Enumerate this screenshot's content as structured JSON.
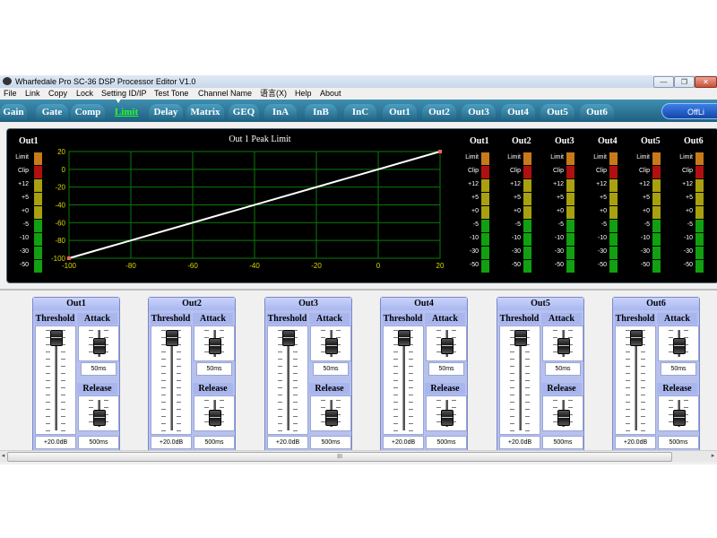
{
  "window": {
    "title": "Wharfedale Pro SC-36 DSP Processor Editor V1.0",
    "minimize_glyph": "—",
    "restore_glyph": "❐",
    "close_glyph": "✕"
  },
  "menu": [
    "File",
    "Link",
    "Copy",
    "Lock",
    "Setting ID/IP",
    "Test Tone",
    "Channel Name",
    "语言(X)",
    "Help",
    "About"
  ],
  "tabs": [
    {
      "label": "Gain",
      "active": false
    },
    {
      "label": "Gate",
      "active": false
    },
    {
      "label": "Comp",
      "active": false
    },
    {
      "label": "Limit",
      "active": true
    },
    {
      "label": "Delay",
      "active": false
    },
    {
      "label": "Matrix",
      "active": false
    },
    {
      "label": "GEQ",
      "active": false
    },
    {
      "label": "InA",
      "active": false
    },
    {
      "label": "InB",
      "active": false
    },
    {
      "label": "InC",
      "active": false
    },
    {
      "label": "Out1",
      "active": false
    },
    {
      "label": "Out2",
      "active": false
    },
    {
      "label": "Out3",
      "active": false
    },
    {
      "label": "Out4",
      "active": false
    },
    {
      "label": "Out5",
      "active": false
    },
    {
      "label": "Out6",
      "active": false
    }
  ],
  "offline_button": "OffLi",
  "meter_scale": [
    "Limit",
    "Clip",
    "+12",
    "+5",
    "+0",
    "-5",
    "-10",
    "-30",
    "-50"
  ],
  "meter_colors": {
    "limit": "#c87a1a",
    "clip": "#b01010",
    "yellow": "#a8a010",
    "green": "#10a010"
  },
  "left_meter": {
    "title": "Out1"
  },
  "output_meters": [
    {
      "title": "Out1"
    },
    {
      "title": "Out2"
    },
    {
      "title": "Out3"
    },
    {
      "title": "Out4"
    },
    {
      "title": "Out5"
    },
    {
      "title": "Out6"
    }
  ],
  "chart_data": {
    "type": "line",
    "title": "Out 1  Peak Limit",
    "xlabel": "",
    "ylabel": "",
    "x_ticks": [
      -100,
      -80,
      -60,
      -40,
      -20,
      0,
      20
    ],
    "y_ticks": [
      20,
      0,
      -20,
      -40,
      -60,
      -80,
      -100
    ],
    "xlim": [
      -100,
      20
    ],
    "ylim": [
      -100,
      20
    ],
    "grid": true,
    "line_color": "#ffffff",
    "grid_color": "#0a7a0a",
    "series": [
      {
        "x": [
          -100,
          20
        ],
        "y": [
          -100,
          20
        ]
      }
    ]
  },
  "limit_groups": [
    {
      "title": "Out1",
      "threshold_label": "Threshold",
      "attack_label": "Attack",
      "release_label": "Release",
      "threshold_value": "+20.0dB",
      "attack_value": "50ms",
      "release_value": "500ms",
      "threshold_level": 1.0,
      "attack_level": 0.35,
      "release_level": 0.25
    },
    {
      "title": "Out2",
      "threshold_label": "Threshold",
      "attack_label": "Attack",
      "release_label": "Release",
      "threshold_value": "+20.0dB",
      "attack_value": "50ms",
      "release_value": "500ms",
      "threshold_level": 1.0,
      "attack_level": 0.35,
      "release_level": 0.25
    },
    {
      "title": "Out3",
      "threshold_label": "Threshold",
      "attack_label": "Attack",
      "release_label": "Release",
      "threshold_value": "+20.0dB",
      "attack_value": "50ms",
      "release_value": "500ms",
      "threshold_level": 1.0,
      "attack_level": 0.35,
      "release_level": 0.25
    },
    {
      "title": "Out4",
      "threshold_label": "Threshold",
      "attack_label": "Attack",
      "release_label": "Release",
      "threshold_value": "+20.0dB",
      "attack_value": "50ms",
      "release_value": "500ms",
      "threshold_level": 1.0,
      "attack_level": 0.35,
      "release_level": 0.25
    },
    {
      "title": "Out5",
      "threshold_label": "Threshold",
      "attack_label": "Attack",
      "release_label": "Release",
      "threshold_value": "+20.0dB",
      "attack_value": "50ms",
      "release_value": "500ms",
      "threshold_level": 1.0,
      "attack_level": 0.35,
      "release_level": 0.25
    },
    {
      "title": "Out6",
      "threshold_label": "Threshold",
      "attack_label": "Attack",
      "release_label": "Release",
      "threshold_value": "+20.0dB",
      "attack_value": "50ms",
      "release_value": "500ms",
      "threshold_level": 1.0,
      "attack_level": 0.35,
      "release_level": 0.25
    }
  ],
  "scrollbar": {
    "thumb_glyph": "III",
    "left_arrow": "◂",
    "right_arrow": "▸"
  }
}
